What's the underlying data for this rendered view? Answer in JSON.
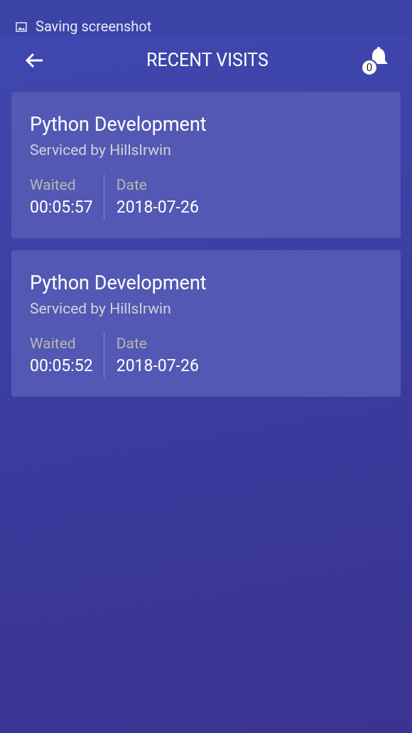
{
  "notification": {
    "text": "Saving screenshot"
  },
  "header": {
    "title": "RECENT VISITS",
    "notification_count": "0"
  },
  "visits": [
    {
      "service": "Python Development",
      "serviced_by": "Serviced by HillsIrwin",
      "waited_label": "Waited",
      "waited": "00:05:57",
      "date_label": "Date",
      "date": "2018-07-26"
    },
    {
      "service": "Python Development",
      "serviced_by": "Serviced by HillsIrwin",
      "waited_label": "Waited",
      "waited": "00:05:52",
      "date_label": "Date",
      "date": "2018-07-26"
    }
  ]
}
